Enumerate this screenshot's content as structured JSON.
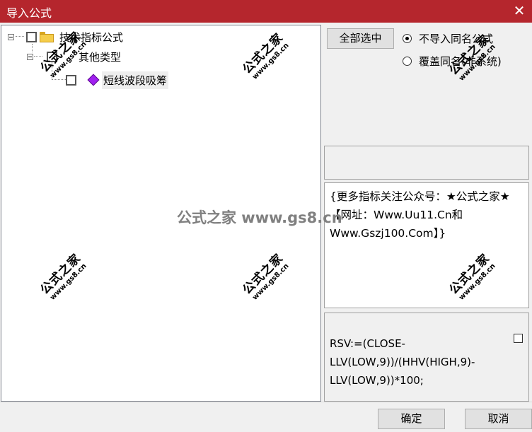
{
  "window": {
    "title": "导入公式",
    "close_glyph": "✕"
  },
  "tree": {
    "root": {
      "label": "技术指标公式",
      "checked": false
    },
    "group": {
      "label": "其他类型",
      "checked": false
    },
    "item": {
      "label": "短线波段吸筹",
      "checked": false
    }
  },
  "options": {
    "select_all_label": "全部选中",
    "radio_no_import_label": "不导入同名公式",
    "radio_overwrite_label": "覆盖同名(非系统)",
    "selected": "no_import"
  },
  "description": "{更多指标关注公众号：★公式之家★ 【网址：Www.Uu11.Cn和Www.Gszj100.Com】}",
  "formula_text": "RSV:=(CLOSE-LLV(LOW,9))/(HHV(HIGH,9)-LLV(LOW,9))*100;",
  "buttons": {
    "ok_label": "确定",
    "cancel_label": "取消"
  },
  "watermark": {
    "line1": "公式之家",
    "line2": "www.gs8.cn",
    "center": "公式之家 www.gs8.cn"
  }
}
